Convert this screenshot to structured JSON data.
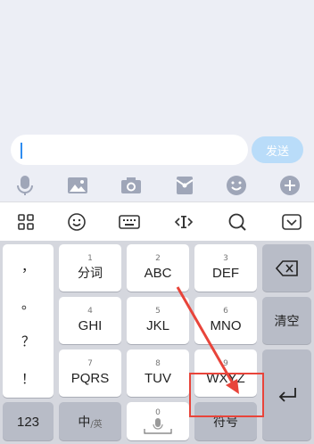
{
  "input_bar": {
    "placeholder": "",
    "send_label": "发送"
  },
  "tools": [
    "microphone-icon",
    "image-icon",
    "camera-icon",
    "red-packet-icon",
    "emoji-icon",
    "plus-icon"
  ],
  "keyboard_toolbar": [
    "grid-icon",
    "emoji-icon",
    "keyboard-icon",
    "cursor-move-icon",
    "search-icon",
    "collapse-keyboard-icon"
  ],
  "keyboard": {
    "punctuation": [
      "，",
      "。",
      "？",
      "！"
    ],
    "keys": {
      "k1": {
        "num": "1",
        "label": "分词"
      },
      "k2": {
        "num": "2",
        "label": "ABC"
      },
      "k3": {
        "num": "3",
        "label": "DEF"
      },
      "k4": {
        "num": "4",
        "label": "GHI"
      },
      "k5": {
        "num": "5",
        "label": "JKL"
      },
      "k6": {
        "num": "6",
        "label": "MNO"
      },
      "k7": {
        "num": "7",
        "label": "PQRS"
      },
      "k8": {
        "num": "8",
        "label": "TUV"
      },
      "k9": {
        "num": "9",
        "label": "WXYZ"
      },
      "k0": {
        "num": "0"
      }
    },
    "clear_label": "清空",
    "num_label": "123",
    "lang_label_main": "中",
    "lang_label_sub": "/英",
    "symbol_label": "符号"
  },
  "colors": {
    "accent": "#2f8cf0",
    "send_disabled": "#b9dcf9",
    "annotation": "#e8443a"
  }
}
